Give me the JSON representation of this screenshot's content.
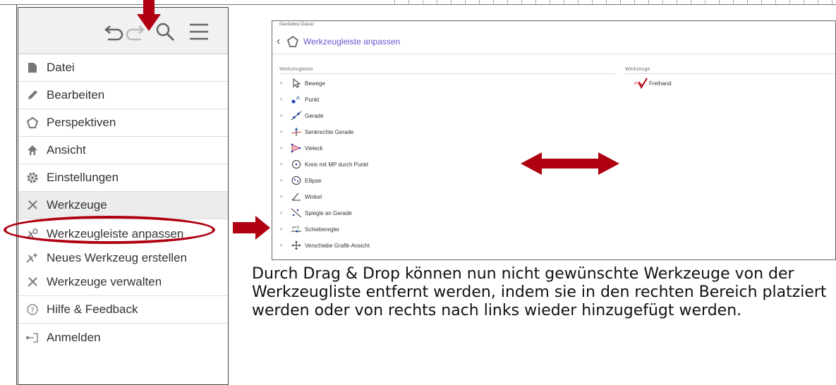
{
  "colors": {
    "accent_red": "#b00010",
    "geogebra_purple": "#6557d2"
  },
  "menu": {
    "toolbar_icons": [
      "undo-icon",
      "redo-icon",
      "search-icon",
      "menu-icon"
    ],
    "items": [
      {
        "label": "Datei",
        "icon": "file-icon"
      },
      {
        "label": "Bearbeiten",
        "icon": "pencil-icon"
      },
      {
        "label": "Perspektiven",
        "icon": "perspectives-icon"
      },
      {
        "label": "Ansicht",
        "icon": "home-icon"
      },
      {
        "label": "Einstellungen",
        "icon": "gear-icon"
      },
      {
        "label": "Werkzeuge",
        "icon": "tools-icon"
      }
    ],
    "sub_items": [
      {
        "label": "Werkzeugleiste anpassen",
        "icon": "customize-toolbar-icon"
      },
      {
        "label": "Neues Werkzeug erstellen",
        "icon": "new-tool-icon"
      },
      {
        "label": "Werkzeuge verwalten",
        "icon": "manage-tools-icon"
      }
    ],
    "items_after": [
      {
        "label": "Hilfe & Feedback",
        "icon": "help-icon"
      },
      {
        "label": "Anmelden",
        "icon": "login-icon"
      }
    ]
  },
  "screenshot": {
    "window_title": "GeoGebra Classic",
    "header_title": "Werkzeugleiste anpassen",
    "left_column_label": "Werkzeugleiste",
    "right_column_label": "Werkzeuge",
    "toolbar_tools": [
      "Bewege",
      "Punkt",
      "Gerade",
      "Senkrechte Gerade",
      "Vieleck",
      "Kreis mit MP durch Punkt",
      "Ellipse",
      "Winkel",
      "Spiegle an Gerade",
      "Schieberegler",
      "Verschiebe Grafik-Ansicht"
    ],
    "available_tools": [
      "Freihand"
    ]
  },
  "caption": "Durch Drag & Drop können nun nicht gewünschte Werkzeuge von der Werkzeugliste entfernt werden, indem sie in den rechten Bereich platziert werden oder von rechts nach links wieder hinzugefügt werden."
}
